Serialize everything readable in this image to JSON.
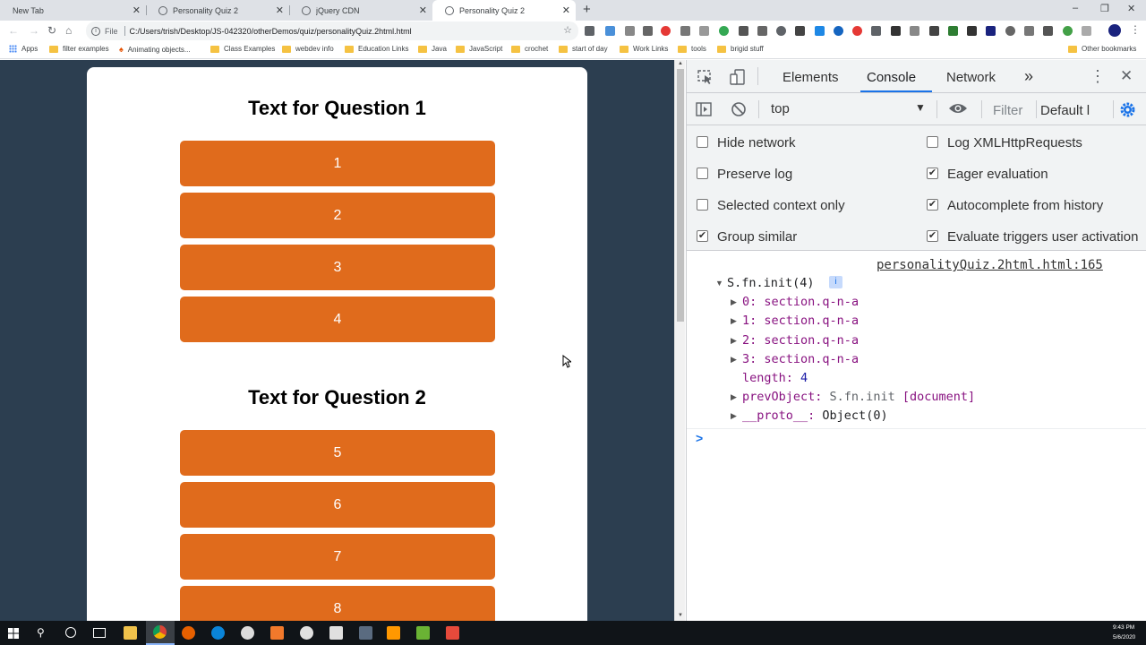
{
  "browser": {
    "tabs": [
      {
        "label": "New Tab"
      },
      {
        "label": "Personality Quiz 2"
      },
      {
        "label": "jQuery CDN"
      },
      {
        "label": "Personality Quiz 2"
      }
    ],
    "address": {
      "scheme_label": "File",
      "url": "C:/Users/trish/Desktop/JS-042320/otherDemos/quiz/personalityQuiz.2html.html"
    },
    "bookmarks": {
      "apps": "Apps",
      "items": [
        "filter examples",
        "Animating objects...",
        "Class Examples",
        "webdev info",
        "Education Links",
        "Java",
        "JavaScript",
        "crochet",
        "start of day",
        "Work Links",
        "tools",
        "brigid stuff"
      ],
      "other": "Other bookmarks"
    }
  },
  "quiz": {
    "questions": [
      {
        "title": "Text for Question 1",
        "answers": [
          "1",
          "2",
          "3",
          "4"
        ]
      },
      {
        "title": "Text for Question 2",
        "answers": [
          "5",
          "6",
          "7",
          "8"
        ]
      }
    ],
    "colors": {
      "page_bg": "#2c3e50",
      "answer_bg": "#e06b1c"
    }
  },
  "devtools": {
    "tabs": {
      "elements": "Elements",
      "console": "Console",
      "network": "Network",
      "more": "»"
    },
    "filterbar": {
      "context": "top",
      "filter_placeholder": "Filter",
      "levels": "Default l"
    },
    "settings": {
      "hide_network": {
        "label": "Hide network",
        "checked": false
      },
      "log_xhr": {
        "label": "Log XMLHttpRequests",
        "checked": false
      },
      "preserve_log": {
        "label": "Preserve log",
        "checked": false
      },
      "eager_eval": {
        "label": "Eager evaluation",
        "checked": true
      },
      "selected_context": {
        "label": "Selected context only",
        "checked": false
      },
      "autocomplete": {
        "label": "Autocomplete from history",
        "checked": true
      },
      "group_similar": {
        "label": "Group similar",
        "checked": true
      },
      "eval_triggers": {
        "label": "Evaluate triggers user activation",
        "checked": true
      }
    },
    "console": {
      "source_link": "personalityQuiz.2html.html:165",
      "object_header": "S.fn.init(4)",
      "entries": [
        {
          "key": "0",
          "value": "section.q-n-a"
        },
        {
          "key": "1",
          "value": "section.q-n-a"
        },
        {
          "key": "2",
          "value": "section.q-n-a"
        },
        {
          "key": "3",
          "value": "section.q-n-a"
        }
      ],
      "length_key": "length",
      "length_value": "4",
      "prev_key": "prevObject",
      "prev_value_a": "S.fn.init",
      "prev_value_b": "[document]",
      "proto_key": "__proto__",
      "proto_value": "Object(0)",
      "prompt": ">"
    }
  },
  "taskbar": {
    "time": "9:43 PM",
    "date": "5/6/2020"
  }
}
